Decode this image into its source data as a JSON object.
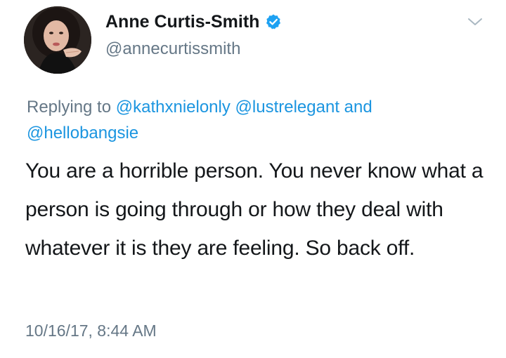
{
  "tweet": {
    "author": {
      "display_name": "Anne Curtis-Smith",
      "handle": "@annecurtissmith",
      "verified": true,
      "avatar_icon": "profile-photo"
    },
    "menu_icon": "chevron-down-icon",
    "reply": {
      "prefix": "Replying to",
      "mentions": [
        "@kathxnielonly",
        "@lustrelegant",
        "@hellobangsie"
      ],
      "conjunction": "and"
    },
    "text": "You are a horrible person. You never know what a person is going through or how they deal with whatever it is they are feeling. So back off.",
    "timestamp": "10/16/17, 8:44 AM"
  },
  "colors": {
    "text": "#14171a",
    "secondary": "#657786",
    "link": "#1b95e0",
    "verified": "#1da1f2"
  }
}
